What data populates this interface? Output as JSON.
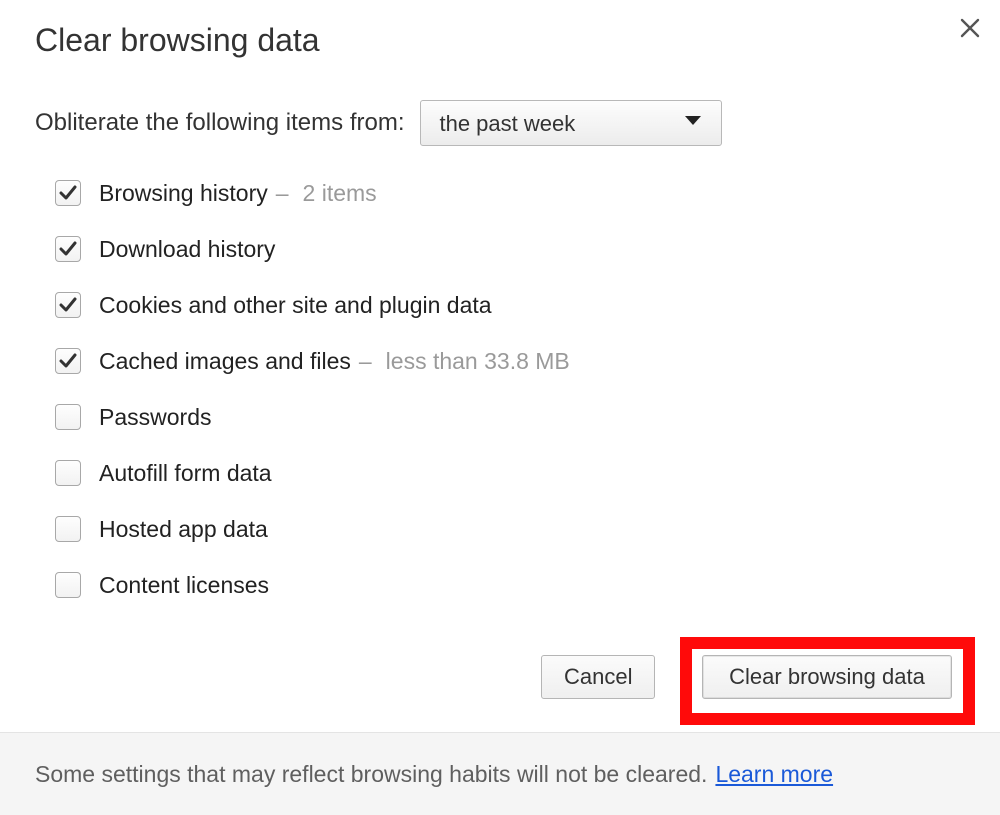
{
  "dialog": {
    "title": "Clear browsing data",
    "time_label": "Obliterate the following items from:",
    "time_selected": "the past week",
    "options": [
      {
        "label": "Browsing history",
        "checked": true,
        "note": "2 items"
      },
      {
        "label": "Download history",
        "checked": true,
        "note": ""
      },
      {
        "label": "Cookies and other site and plugin data",
        "checked": true,
        "note": ""
      },
      {
        "label": "Cached images and files",
        "checked": true,
        "note": "less than 33.8 MB"
      },
      {
        "label": "Passwords",
        "checked": false,
        "note": ""
      },
      {
        "label": "Autofill form data",
        "checked": false,
        "note": ""
      },
      {
        "label": "Hosted app data",
        "checked": false,
        "note": ""
      },
      {
        "label": "Content licenses",
        "checked": false,
        "note": ""
      }
    ],
    "buttons": {
      "cancel": "Cancel",
      "clear": "Clear browsing data"
    },
    "footer_text": "Some settings that may reflect browsing habits will not be cleared.",
    "footer_link": "Learn more"
  }
}
